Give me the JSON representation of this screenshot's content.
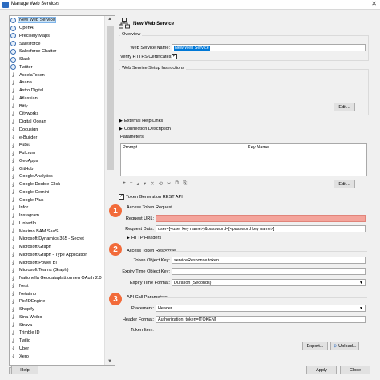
{
  "window": {
    "title": "Manage Web Services",
    "close": "✕"
  },
  "services": [
    {
      "label": "New Web Service",
      "icon": "globe-icon",
      "selected": true
    },
    {
      "label": "OpenAI",
      "icon": "globe-icon"
    },
    {
      "label": "Precisely Maps",
      "icon": "globe-icon"
    },
    {
      "label": "Salesforce",
      "icon": "globe-icon"
    },
    {
      "label": "Salesforce Chatter",
      "icon": "globe-icon"
    },
    {
      "label": "Slack",
      "icon": "globe-icon"
    },
    {
      "label": "Twitter",
      "icon": "globe-icon"
    },
    {
      "label": "AccelaToken",
      "icon": "download-icon"
    },
    {
      "label": "Asana",
      "icon": "download-icon"
    },
    {
      "label": "Astro Digital",
      "icon": "download-icon"
    },
    {
      "label": "Atlassian",
      "icon": "download-icon"
    },
    {
      "label": "Bitly",
      "icon": "download-icon"
    },
    {
      "label": "Cityworks",
      "icon": "download-icon"
    },
    {
      "label": "Digital Ocean",
      "icon": "download-icon"
    },
    {
      "label": "Docusign",
      "icon": "download-icon"
    },
    {
      "label": "e-Builder",
      "icon": "download-icon"
    },
    {
      "label": "FitBit",
      "icon": "download-icon"
    },
    {
      "label": "Fulcrum",
      "icon": "download-icon"
    },
    {
      "label": "GeoApps",
      "icon": "download-icon"
    },
    {
      "label": "GitHub",
      "icon": "download-icon"
    },
    {
      "label": "Google Analytics",
      "icon": "download-icon"
    },
    {
      "label": "Google Double Click",
      "icon": "download-icon"
    },
    {
      "label": "Google Gemini",
      "icon": "download-icon"
    },
    {
      "label": "Google Plus",
      "icon": "download-icon"
    },
    {
      "label": "Infor",
      "icon": "download-icon"
    },
    {
      "label": "Instagram",
      "icon": "download-icon"
    },
    {
      "label": "LinkedIn",
      "icon": "download-icon"
    },
    {
      "label": "Maximo BAM SaaS",
      "icon": "download-icon"
    },
    {
      "label": "Microsoft Dynamics 365 - Secret",
      "icon": "download-icon"
    },
    {
      "label": "Microsoft Graph",
      "icon": "download-icon"
    },
    {
      "label": "Microsoft Graph - Type Application",
      "icon": "download-icon"
    },
    {
      "label": "Microsoft Power BI",
      "icon": "download-icon"
    },
    {
      "label": "Microsoft Teams (Graph)",
      "icon": "download-icon"
    },
    {
      "label": "Nationella Geodataplattformen OAuth 2.0",
      "icon": "download-icon"
    },
    {
      "label": "Nest",
      "icon": "download-icon"
    },
    {
      "label": "Netatmo",
      "icon": "download-icon"
    },
    {
      "label": "Pix4DEngine",
      "icon": "download-icon"
    },
    {
      "label": "Shopify",
      "icon": "download-icon"
    },
    {
      "label": "Sina Weibo",
      "icon": "download-icon"
    },
    {
      "label": "Strava",
      "icon": "download-icon"
    },
    {
      "label": "Trimble ID",
      "icon": "download-icon"
    },
    {
      "label": "Twilio",
      "icon": "download-icon"
    },
    {
      "label": "Uber",
      "icon": "download-icon"
    },
    {
      "label": "Xero",
      "icon": "download-icon"
    }
  ],
  "list_controls": {
    "add": "+",
    "add_chev": "▾",
    "remove": "−"
  },
  "header": {
    "title": "New Web Service"
  },
  "overview": {
    "label": "Overview",
    "name_label": "Web Service Name:",
    "name_value": "New Web Service",
    "verify_label": "Verify HTTPS Certificates:",
    "verify_checked": "✓"
  },
  "setup": {
    "label": "Web Service Setup Instructions",
    "edit": "Edit..."
  },
  "sections": {
    "help_links": "External Help Links",
    "connection": "Connection Description",
    "http_headers": "HTTP Headers"
  },
  "parameters": {
    "label": "Parameters",
    "col_prompt": "Prompt",
    "col_key": "Key Name",
    "edit": "Edit...",
    "toolbar": [
      "+",
      "−",
      "▴",
      "▾",
      "✕",
      "⟲",
      "✂",
      "⧉",
      "⎘"
    ]
  },
  "token": {
    "checkbox_label": "Token Generation REST API",
    "checked": "✓",
    "request_label": "Access Token Request",
    "url_label": "Request URL:",
    "url_value": "",
    "data_label": "Request Data:",
    "data_value": "user=[<user key name>]&password=[<password key name>]",
    "response_label": "Access Token Response",
    "obj_key_label": "Token Object Key:",
    "obj_key_value": "serviceResponse.token",
    "expiry_key_label": "Expiry Time Object Key:",
    "expiry_key_value": "",
    "expiry_format_label": "Expiry Time Format:",
    "expiry_format_value": "Duration (Seconds)"
  },
  "api_params": {
    "label": "API Call Parameters",
    "placement_label": "Placement:",
    "placement_value": "Header",
    "header_format_label": "Header Format:",
    "header_format_value": "Authorization: token=[TOKEN]",
    "token_item_label": "Token Item:",
    "token_item_value": ""
  },
  "badges": [
    "1",
    "2",
    "3"
  ],
  "buttons": {
    "export": "Export...",
    "upload": "Upload...",
    "help": "Help",
    "apply": "Apply",
    "close": "Close"
  },
  "colors": {
    "selection": "#0078d7",
    "required": "#f4a49b",
    "badge": "#f26b3a"
  }
}
